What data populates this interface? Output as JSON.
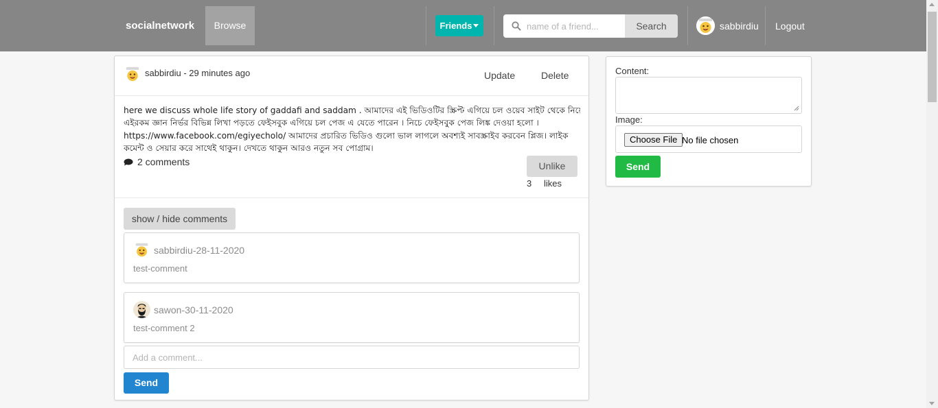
{
  "navbar": {
    "brand": "socialnetwork",
    "browse_label": "Browse",
    "friends_label": "Friends",
    "search_placeholder": "name of a friend...",
    "search_button": "Search",
    "username": "sabbirdiu",
    "logout_label": "Logout",
    "background_color": "#868686"
  },
  "post": {
    "author_meta": "sabbirdiu - 29 minutes ago",
    "update_label": "Update",
    "delete_label": "Delete",
    "body_lines": [
      "here we discuss whole life story of gaddafi and saddam . আমাদের এই ভিডিওটির স্ক্রিপ্ট এগিয়ে চল ওয়েব সাইট থেকে নিয়েছি ,",
      "এইরকম জ্ঞান নির্ভর বিভিন্ন লিখা পড়তে ফেইসবুক এগিয়ে চল পেজ এ যেতে পারেন । নিচে ফেইসবুক পেজ লিঙ্ক দেওয়া হলো ।",
      "https://www.facebook.com/egiyecholo/ আমাদের প্রচারিত ভিডিও গুলো ভাল লাগলে অবশ্যই সাবস্ক্রাইব করবেন প্লিজ। লাইক",
      "কমেন্ট ও সেয়ার করে সাথেই থাকুন। দেখতে থাকুন আরও নতুন সব পোগ্রাম।"
    ],
    "comment_count_label": "2 comments",
    "unlike_label": "Unlike",
    "likes_count": "3",
    "likes_label": "likes",
    "toggle_comments_label": "show / hide comments"
  },
  "comments": [
    {
      "author": "sabbirdiu-28-11-2020",
      "text": "test-comment",
      "avatar": "emoji-avatar"
    },
    {
      "author": "sawon-30-11-2020",
      "text": "test-comment 2",
      "avatar": "bearded-man-avatar"
    }
  ],
  "add_comment": {
    "placeholder": "Add a comment...",
    "send_label": "Send",
    "send_color": "#2185d0"
  },
  "new_post_form": {
    "content_label": "Content:",
    "image_label": "Image:",
    "choose_file_label": "Choose File",
    "no_file_label": "No file chosen",
    "send_label": "Send",
    "send_color": "#21ba45"
  },
  "icons": {
    "search": "search-icon",
    "comment": "comment-icon",
    "caret": "caret-down-icon"
  }
}
